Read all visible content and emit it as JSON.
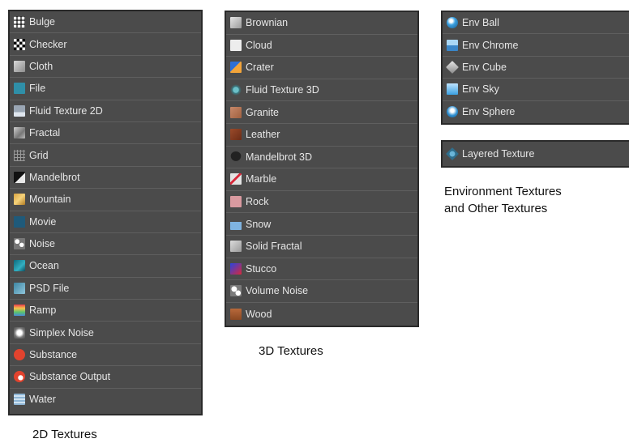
{
  "panels": {
    "textures_2d": {
      "caption": "2D Textures",
      "items": [
        {
          "label": "Bulge",
          "icon": "bulge-icon"
        },
        {
          "label": "Checker",
          "icon": "checker-icon"
        },
        {
          "label": "Cloth",
          "icon": "cloth-icon"
        },
        {
          "label": "File",
          "icon": "file-icon"
        },
        {
          "label": "Fluid Texture 2D",
          "icon": "fluid-texture-2d-icon"
        },
        {
          "label": "Fractal",
          "icon": "fractal-icon"
        },
        {
          "label": "Grid",
          "icon": "grid-icon"
        },
        {
          "label": "Mandelbrot",
          "icon": "mandelbrot-icon"
        },
        {
          "label": "Mountain",
          "icon": "mountain-icon"
        },
        {
          "label": "Movie",
          "icon": "movie-icon"
        },
        {
          "label": "Noise",
          "icon": "noise-icon"
        },
        {
          "label": "Ocean",
          "icon": "ocean-icon"
        },
        {
          "label": "PSD File",
          "icon": "psd-file-icon"
        },
        {
          "label": "Ramp",
          "icon": "ramp-icon"
        },
        {
          "label": "Simplex Noise",
          "icon": "simplex-noise-icon"
        },
        {
          "label": "Substance",
          "icon": "substance-icon"
        },
        {
          "label": "Substance Output",
          "icon": "substance-output-icon"
        },
        {
          "label": "Water",
          "icon": "water-icon"
        }
      ]
    },
    "textures_3d": {
      "caption": "3D Textures",
      "items": [
        {
          "label": "Brownian",
          "icon": "brownian-icon"
        },
        {
          "label": "Cloud",
          "icon": "cloud-icon"
        },
        {
          "label": "Crater",
          "icon": "crater-icon"
        },
        {
          "label": "Fluid Texture 3D",
          "icon": "fluid-texture-3d-icon"
        },
        {
          "label": "Granite",
          "icon": "granite-icon"
        },
        {
          "label": "Leather",
          "icon": "leather-icon"
        },
        {
          "label": "Mandelbrot 3D",
          "icon": "mandelbrot-3d-icon"
        },
        {
          "label": "Marble",
          "icon": "marble-icon"
        },
        {
          "label": "Rock",
          "icon": "rock-icon"
        },
        {
          "label": "Snow",
          "icon": "snow-icon"
        },
        {
          "label": "Solid Fractal",
          "icon": "solid-fractal-icon"
        },
        {
          "label": "Stucco",
          "icon": "stucco-icon"
        },
        {
          "label": "Volume Noise",
          "icon": "volume-noise-icon"
        },
        {
          "label": "Wood",
          "icon": "wood-icon"
        }
      ]
    },
    "environment_textures": {
      "items": [
        {
          "label": "Env Ball",
          "icon": "env-ball-icon"
        },
        {
          "label": "Env Chrome",
          "icon": "env-chrome-icon"
        },
        {
          "label": "Env Cube",
          "icon": "env-cube-icon"
        },
        {
          "label": "Env Sky",
          "icon": "env-sky-icon"
        },
        {
          "label": "Env Sphere",
          "icon": "env-sphere-icon"
        }
      ]
    },
    "other_textures": {
      "items": [
        {
          "label": "Layered Texture",
          "icon": "layered-texture-icon"
        }
      ]
    },
    "env_other_caption_line1": "Environment Textures",
    "env_other_caption_line2": "and Other Textures"
  },
  "colors": {
    "panel_background": "#4b4b4b",
    "panel_border": "#2a2a2a",
    "row_divider": "#5f5f5f",
    "item_text": "#e6e6e6",
    "caption_text": "#111111"
  }
}
